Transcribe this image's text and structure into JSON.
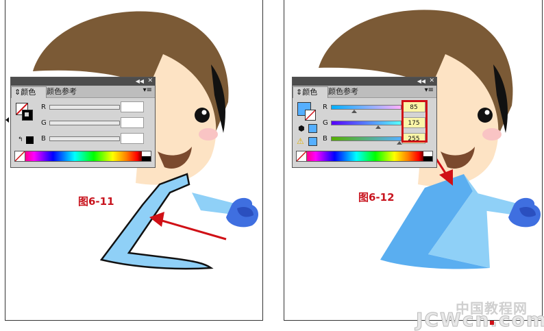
{
  "figures": [
    {
      "caption": "图6-11",
      "panel": {
        "tab_active": "颜色",
        "tab_inactive": "颜色参考",
        "channels": [
          {
            "label": "R",
            "value": ""
          },
          {
            "label": "G",
            "value": ""
          },
          {
            "label": "B",
            "value": ""
          }
        ]
      }
    },
    {
      "caption": "图6-12",
      "panel": {
        "tab_active": "颜色",
        "tab_inactive": "颜色参考",
        "channels": [
          {
            "label": "R",
            "value": "85"
          },
          {
            "label": "G",
            "value": "175"
          },
          {
            "label": "B",
            "value": "255"
          }
        ]
      }
    }
  ],
  "watermark": {
    "cn": "中国教程网",
    "en": "JCWcn.com"
  },
  "colors": {
    "hair": "#7b5a36",
    "skin": "#fde3c4",
    "shirt_light": "#8fd0f7",
    "shirt_dark": "#5aaef0",
    "glove": "#3f6fe0",
    "arrow": "#d01016",
    "swatch_fill": "#55afff"
  },
  "icons": {
    "collapse": "double-chevron-left-icon",
    "close": "close-icon",
    "menu": "panel-menu-icon",
    "warning": "warning-icon",
    "cube": "out-of-gamut-cube-icon"
  }
}
